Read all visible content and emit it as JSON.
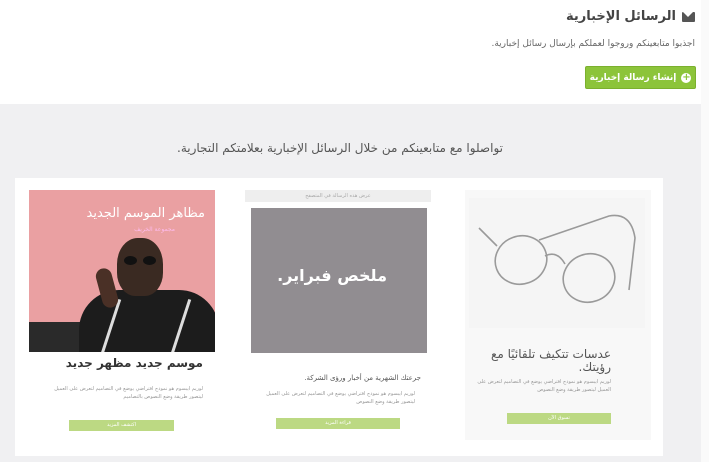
{
  "header": {
    "title": "الرسائل الإخبارية",
    "subtitle": "اجذبوا متابعينكم وروجوا لعملكم بإرسال رسائل إخبارية.",
    "create_button": "إنشاء رسالة إخبارية"
  },
  "panel": {
    "tagline": "تواصلوا مع متابعينكم من خلال الرسائل الإخبارية بعلامتكم التجارية."
  },
  "templates": [
    {
      "hero_title": "مظاهر الموسم الجديد",
      "hero_subtitle": "مجموعة الخريف",
      "main_title": "موسم جديد مظهر جديد",
      "body": "لوريم ايبسوم هو نموذج افتراضي يوضع في التصاميم لتعرض على العميل ليتصور طريقة وضع النصوص بالتصاميم",
      "button": "اكتشف المزيد"
    },
    {
      "topbar": "عرض هذه الرسالة في المتصفح",
      "hero_title": "ملخص فبراير.",
      "main_title": "جرعتك الشهرية من أخبار ورؤى الشركة.",
      "body": "لوريم ايبسوم هو نموذج افتراضي يوضع في التصاميم لتعرض على العميل ليتصور طريقة وضع النصوص",
      "button": "قراءة المزيد"
    },
    {
      "main_title": "عدسات تتكيف تلقائيًا مع رؤيتك.",
      "body": "لوريم ايبسوم هو نموذج افتراضي يوضع في التصاميم لتعرض على العميل ليتصور طريقة وضع النصوص",
      "button": "تسوق الآن"
    }
  ],
  "colors": {
    "accent_green": "#8cc43a",
    "light_green": "#bcd983",
    "pink_hero": "#eaa0a2",
    "gray_hero": "#918d91"
  }
}
